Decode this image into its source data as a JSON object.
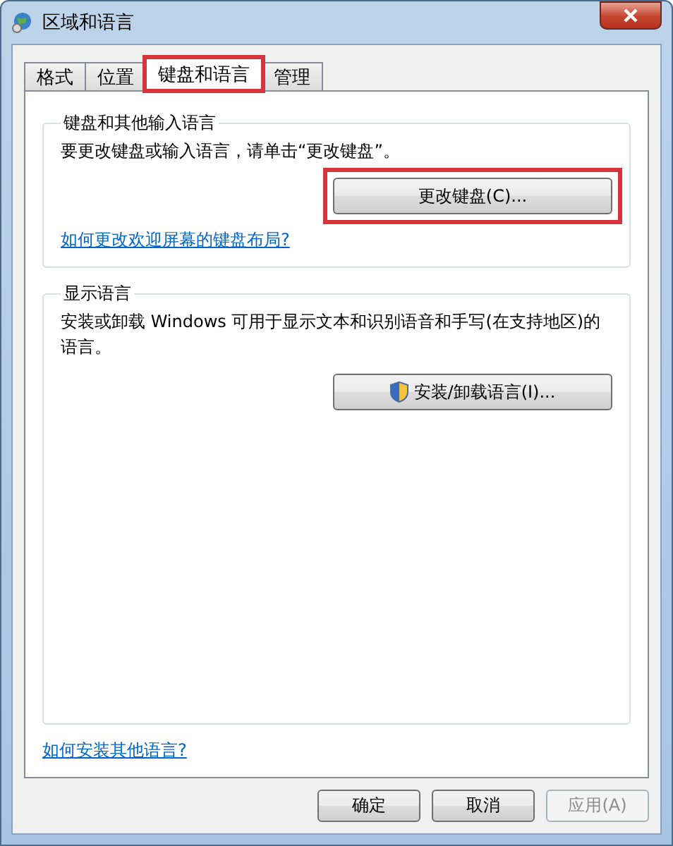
{
  "window": {
    "title": "区域和语言"
  },
  "tabs": [
    {
      "label": "格式",
      "selected": false,
      "highlighted": false
    },
    {
      "label": "位置",
      "selected": false,
      "highlighted": false
    },
    {
      "label": "键盘和语言",
      "selected": true,
      "highlighted": true
    },
    {
      "label": "管理",
      "selected": false,
      "highlighted": false
    }
  ],
  "groups": [
    {
      "title": "键盘和其他输入语言",
      "text": "要更改键盘或输入语言，请单击“更改键盘”。",
      "button": {
        "label": "更改键盘(C)...",
        "shield": false,
        "highlighted": true
      },
      "link": "如何更改欢迎屏幕的键盘布局?"
    },
    {
      "title": "显示语言",
      "text": "安装或卸载 Windows 可用于显示文本和识别语音和手写(在支持地区)的语言。",
      "button": {
        "label": "安装/卸载语言(I)...",
        "shield": true,
        "highlighted": false
      }
    }
  ],
  "bottom_link": "如何安装其他语言?",
  "buttons": [
    {
      "label": "确定",
      "disabled": false
    },
    {
      "label": "取消",
      "disabled": false
    },
    {
      "label": "应用(A)",
      "disabled": true
    }
  ]
}
